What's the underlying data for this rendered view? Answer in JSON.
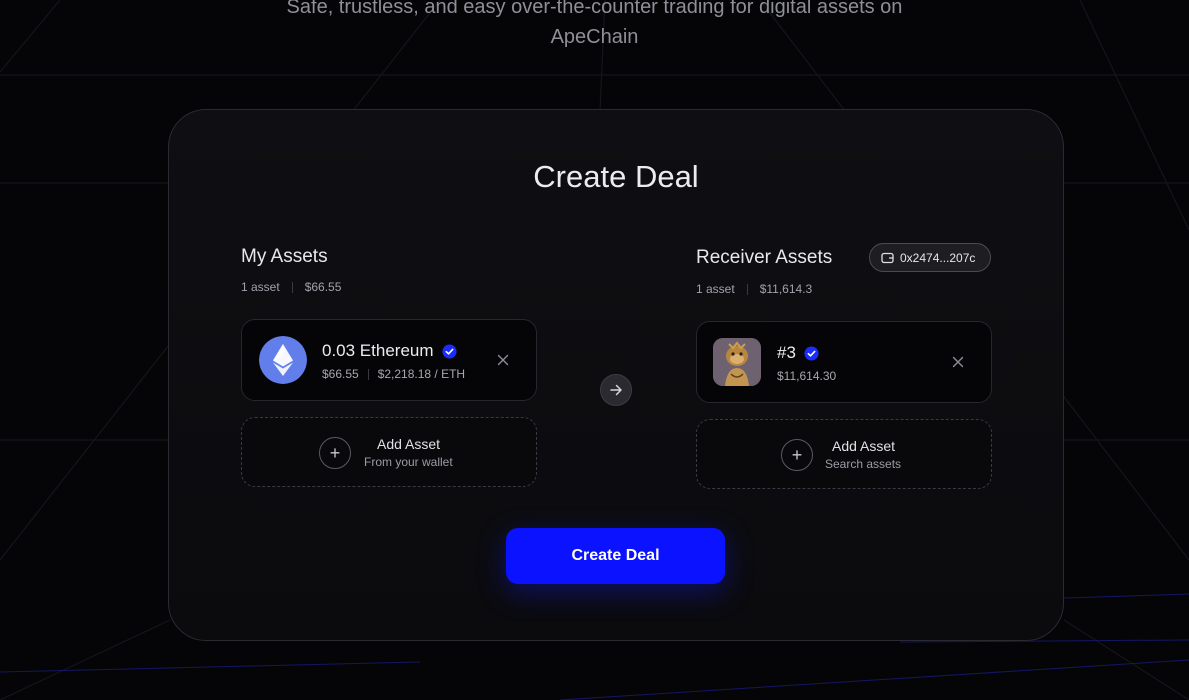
{
  "hero": {
    "subtitle_line1": "Safe, trustless, and easy over-the-counter trading for digital assets on",
    "subtitle_line2": "ApeChain"
  },
  "deal": {
    "title": "Create Deal",
    "submit_label": "Create Deal"
  },
  "my_assets": {
    "title": "My Assets",
    "count": "1 asset",
    "total": "$66.55",
    "items": [
      {
        "name": "0.03 Ethereum",
        "value": "$66.55",
        "price": "$2,218.18 / ETH",
        "icon": "ethereum-icon"
      }
    ],
    "add_label": "Add Asset",
    "add_sub": "From your wallet"
  },
  "receiver_assets": {
    "title": "Receiver Assets",
    "wallet": "0x2474...207c",
    "count": "1 asset",
    "total": "$11,614.3",
    "items": [
      {
        "name": "#3",
        "value": "$11,614.30",
        "icon": "nft-ape-thumbnail"
      }
    ],
    "add_label": "Add Asset",
    "add_sub": "Search assets"
  },
  "colors": {
    "accent": "#0a12ff",
    "verified": "#1a2cff",
    "background": "#050507"
  }
}
